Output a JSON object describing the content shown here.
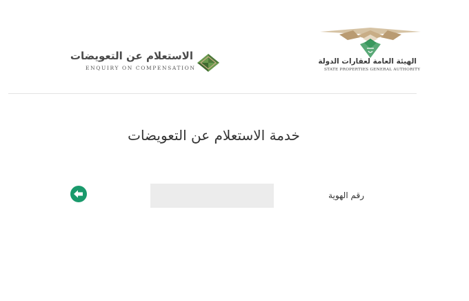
{
  "header": {
    "enquiry_logo": {
      "title_ar": "الاستعلام عن التعويضات",
      "title_en": "ENQUIRY ON COMPENSATION",
      "icon": "green-diamond-icon"
    },
    "authority_logo": {
      "name_ar": "الهيئة العامة لعقارات الدولة",
      "name_en": "STATE PROPERTIES GENERAL AUTHORITY",
      "icon": "state-emblem-icon"
    }
  },
  "main": {
    "title": "خدمة الاستعلام عن التعويضات",
    "id_field": {
      "label": "رقم الهوية",
      "value": "",
      "placeholder": ""
    },
    "submit_icon": "arrow-left-circle-icon"
  },
  "colors": {
    "accent_green": "#1a9a6c",
    "logo_green": "#4d7a3a",
    "logo_tan": "#c8ad86",
    "input_bg": "#ececec",
    "divider": "#e3e3e3"
  }
}
